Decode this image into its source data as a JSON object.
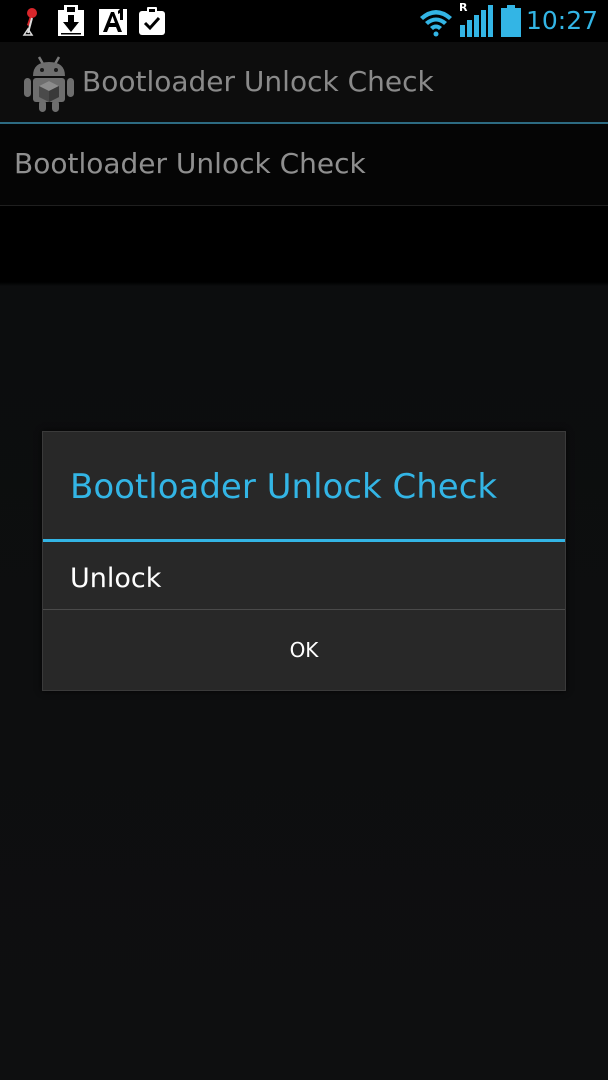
{
  "status_bar": {
    "time": "10:27",
    "roaming_indicator": "R",
    "icons": [
      "pin-icon",
      "download-icon",
      "a1-app-icon",
      "clipboard-check-icon",
      "wifi-icon",
      "signal-icon",
      "battery-icon"
    ],
    "accent_color": "#33b5e5"
  },
  "action_bar": {
    "title": "Bootloader Unlock Check",
    "icon": "android-robot-icon"
  },
  "preferences": {
    "items": [
      {
        "title": "Bootloader Unlock Check"
      }
    ]
  },
  "dialog": {
    "title": "Bootloader Unlock Check",
    "message": "Unlock",
    "ok_label": "OK",
    "title_color": "#33b5e5"
  }
}
